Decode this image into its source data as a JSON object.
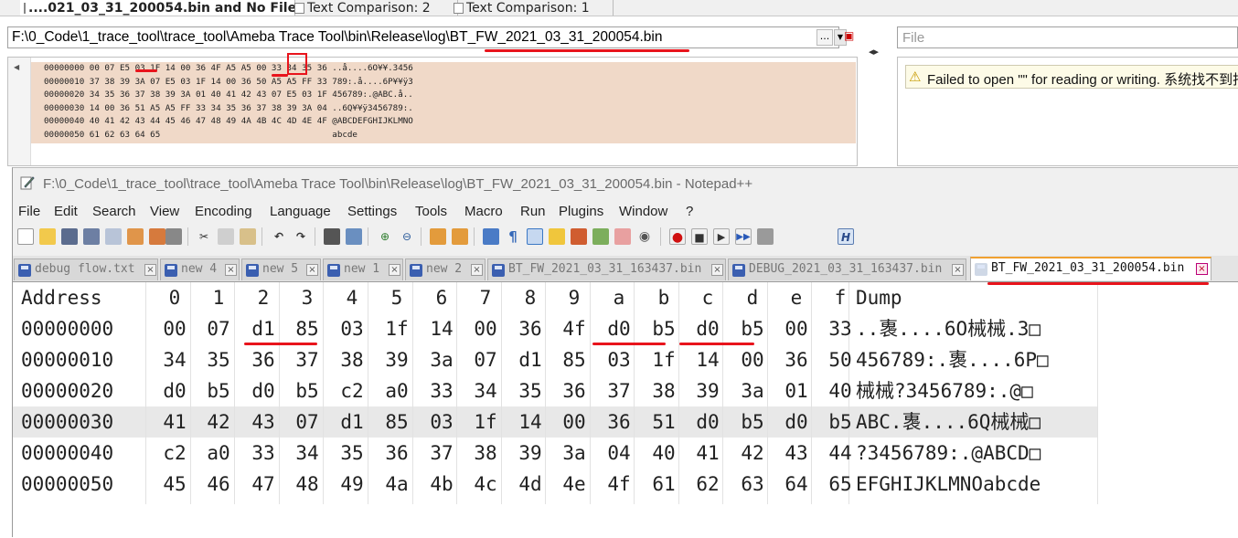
{
  "compare": {
    "tabs": [
      {
        "label": "....021_03_31_200054.bin and No File",
        "active": true
      },
      {
        "label": "Text Comparison: 2",
        "active": false
      },
      {
        "label": "Text Comparison: 1",
        "active": false
      }
    ],
    "path_prefix": "F:\\0_Code\\1_trace_tool\\trace_tool\\Ameba Trace Tool\\bin\\Release\\log\\",
    "path_file": "BT_FW_2021_03_31_200054.bin",
    "browse_label": "...",
    "file_placeholder": "File",
    "error_message": "Failed to open \"\" for reading or writing. 系统找不到指定的文件。",
    "hex_lines": [
      "00000000 00 07 E5 03 1F 14 00 36 4F A5 A5 00 33 34 35 36 ..å....6O¥¥.3456",
      "00000010 37 38 39 3A 07 E5 03 1F 14 00 36 50 A5 A5 FF 33 789:.å....6P¥¥ÿ3",
      "00000020 34 35 36 37 38 39 3A 01 40 41 42 43 07 E5 03 1F 456789:.@ABC.å..",
      "00000030 14 00 36 51 A5 A5 FF 33 34 35 36 37 38 39 3A 04 ..6Q¥¥ÿ3456789:.",
      "00000040 40 41 42 43 44 45 46 47 48 49 4A 4B 4C 4D 4E 4F @ABCDEFGHIJKLMNO",
      "00000050 61 62 63 64 65                                  abcde"
    ]
  },
  "notepad": {
    "title": "F:\\0_Code\\1_trace_tool\\trace_tool\\Ameba Trace Tool\\bin\\Release\\log\\BT_FW_2021_03_31_200054.bin - Notepad++",
    "menu": [
      "File",
      "Edit",
      "Search",
      "View",
      "Encoding",
      "Language",
      "Settings",
      "Tools",
      "Macro",
      "Run",
      "Plugins",
      "Window",
      "?"
    ],
    "tabs": [
      {
        "label": "debug flow.txt",
        "active": false
      },
      {
        "label": "new 4",
        "active": false
      },
      {
        "label": "new 5",
        "active": false
      },
      {
        "label": "new 1",
        "active": false
      },
      {
        "label": "new 2",
        "active": false
      },
      {
        "label": "BT_FW_2021_03_31_163437.bin",
        "active": false
      },
      {
        "label": "DEBUG_2021_03_31_163437.bin",
        "active": false
      },
      {
        "label": "BT_FW_2021_03_31_200054.bin",
        "active": true
      }
    ],
    "header": [
      "Address",
      "0",
      "1",
      "2",
      "3",
      "4",
      "5",
      "6",
      "7",
      "8",
      "9",
      "a",
      "b",
      "c",
      "d",
      "e",
      "f",
      "Dump"
    ],
    "rows": [
      {
        "addr": "00000000",
        "bytes": [
          "00",
          "07",
          "d1",
          "85",
          "03",
          "1f",
          "14",
          "00",
          "36",
          "4f",
          "d0",
          "b5",
          "d0",
          "b5",
          "00",
          "33"
        ],
        "dump": "..褢....6O械械.3□"
      },
      {
        "addr": "00000010",
        "bytes": [
          "34",
          "35",
          "36",
          "37",
          "38",
          "39",
          "3a",
          "07",
          "d1",
          "85",
          "03",
          "1f",
          "14",
          "00",
          "36",
          "50"
        ],
        "dump": "456789:.褢....6P□"
      },
      {
        "addr": "00000020",
        "bytes": [
          "d0",
          "b5",
          "d0",
          "b5",
          "c2",
          "a0",
          "33",
          "34",
          "35",
          "36",
          "37",
          "38",
          "39",
          "3a",
          "01",
          "40"
        ],
        "dump": "械械?3456789:.@□"
      },
      {
        "addr": "00000030",
        "bytes": [
          "41",
          "42",
          "43",
          "07",
          "d1",
          "85",
          "03",
          "1f",
          "14",
          "00",
          "36",
          "51",
          "d0",
          "b5",
          "d0",
          "b5"
        ],
        "dump": "ABC.褢....6Q械械□"
      },
      {
        "addr": "00000040",
        "bytes": [
          "c2",
          "a0",
          "33",
          "34",
          "35",
          "36",
          "37",
          "38",
          "39",
          "3a",
          "04",
          "40",
          "41",
          "42",
          "43",
          "44"
        ],
        "dump": "?3456789:.@ABCD□"
      },
      {
        "addr": "00000050",
        "bytes": [
          "45",
          "46",
          "47",
          "48",
          "49",
          "4a",
          "4b",
          "4c",
          "4d",
          "4e",
          "4f",
          "61",
          "62",
          "63",
          "64",
          "65"
        ],
        "dump": "EFGHIJKLMNOabcde"
      }
    ]
  },
  "colors": {
    "annotation_red": "#e8141c",
    "hex_pane_bg": "#f0d9c8",
    "current_line": "#e8e8e8",
    "active_tab_accent": "#f0a030"
  }
}
